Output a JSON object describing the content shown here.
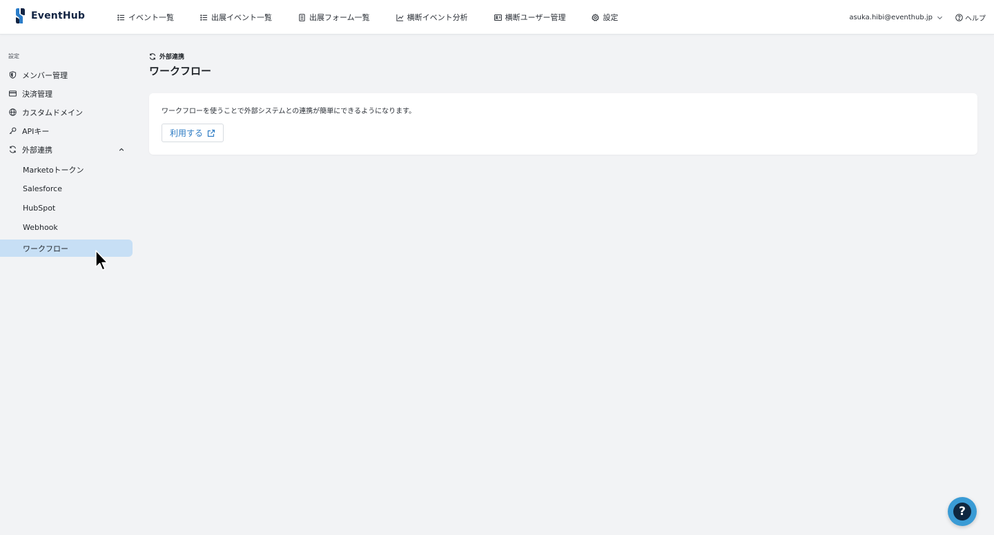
{
  "app": {
    "name": "EventHub",
    "brand_color": "#132544",
    "accent_color": "#2e7cc4"
  },
  "header": {
    "nav": [
      {
        "label": "イベント一覧",
        "icon": "list-icon"
      },
      {
        "label": "出展イベント一覧",
        "icon": "list-icon"
      },
      {
        "label": "出展フォーム一覧",
        "icon": "form-icon"
      },
      {
        "label": "横断イベント分析",
        "icon": "chart-icon"
      },
      {
        "label": "横断ユーザー管理",
        "icon": "id-card-icon"
      },
      {
        "label": "設定",
        "icon": "gear-icon"
      }
    ],
    "user_email": "asuka.hibi@eventhub.jp",
    "help_label": "ヘルプ"
  },
  "sidebar": {
    "heading": "設定",
    "items": [
      {
        "label": "メンバー管理",
        "icon": "shield-icon"
      },
      {
        "label": "決済管理",
        "icon": "credit-card-icon"
      },
      {
        "label": "カスタムドメイン",
        "icon": "globe-icon"
      },
      {
        "label": "APIキー",
        "icon": "key-icon"
      },
      {
        "label": "外部連携",
        "icon": "sync-icon",
        "expanded": true
      }
    ],
    "subitems": [
      {
        "label": "Marketoトークン"
      },
      {
        "label": "Salesforce"
      },
      {
        "label": "HubSpot"
      },
      {
        "label": "Webhook"
      },
      {
        "label": "ワークフロー",
        "active": true
      }
    ],
    "active_color": "#c7dff5"
  },
  "main": {
    "breadcrumb": "外部連携",
    "title": "ワークフロー",
    "card": {
      "description": "ワークフローを使うことで外部システムとの連携が簡単にできるようになります。",
      "button_label": "利用する"
    }
  },
  "fab": {
    "label": "?",
    "color": "#3a9bd5"
  }
}
